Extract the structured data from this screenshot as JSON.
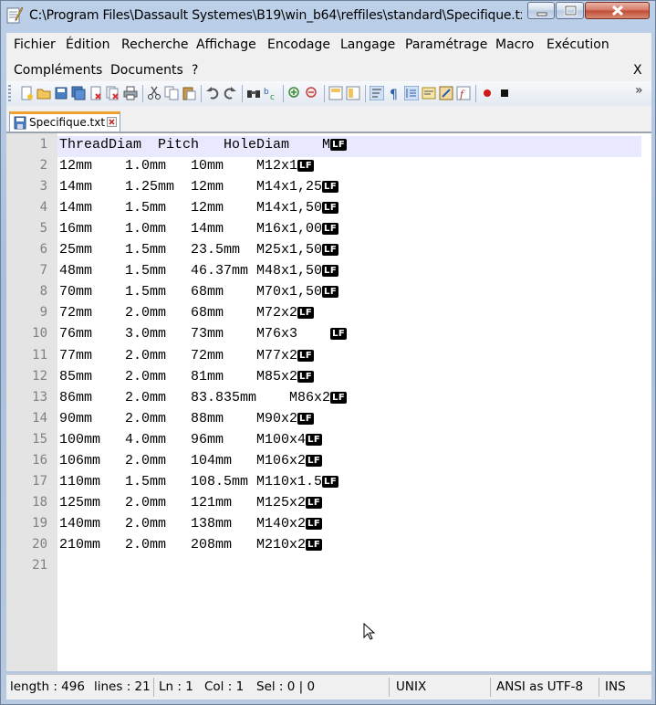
{
  "window": {
    "title": "C:\\Program Files\\Dassault Systemes\\B19\\win_b64\\reffiles\\standard\\Specifique.txt..."
  },
  "menu": {
    "items": [
      "Fichier",
      "Édition",
      "Recherche",
      "Affichage",
      "Encodage",
      "Langage",
      "Paramétrage",
      "Macro",
      "Exécution",
      "Compléments",
      "Documents",
      "?"
    ],
    "close_label": "X"
  },
  "toolbar": {
    "icons": [
      "new-file-icon",
      "open-file-icon",
      "save-icon",
      "save-all-icon",
      "close-icon",
      "close-all-icon",
      "print-icon",
      "cut-icon",
      "copy-icon",
      "paste-icon",
      "undo-icon",
      "redo-icon",
      "find-icon",
      "replace-icon",
      "zoom-in-icon",
      "zoom-out-icon",
      "sync-vertical-icon",
      "sync-horizontal-icon",
      "word-wrap-icon",
      "show-all-chars-icon",
      "indent-guide-icon",
      "user-language-icon",
      "document-map-icon",
      "function-list-icon",
      "record-macro-icon",
      "stop-macro-icon"
    ],
    "overflow": "»"
  },
  "tab": {
    "label": "Specifique.txt"
  },
  "editor": {
    "line_numbers": [
      "1",
      "2",
      "3",
      "4",
      "5",
      "6",
      "7",
      "8",
      "9",
      "10",
      "11",
      "12",
      "13",
      "14",
      "15",
      "16",
      "17",
      "18",
      "19",
      "20",
      "21"
    ],
    "eol_marker": "LF",
    "lines": [
      "ThreadDiam  Pitch   HoleDiam    M",
      "12mm    1.0mm   10mm    M12x1",
      "14mm    1.25mm  12mm    M14x1,25",
      "14mm    1.5mm   12mm    M14x1,50",
      "16mm    1.0mm   14mm    M16x1,00",
      "25mm    1.5mm   23.5mm  M25x1,50",
      "48mm    1.5mm   46.37mm M48x1,50",
      "70mm    1.5mm   68mm    M70x1,50",
      "72mm    2.0mm   68mm    M72x2",
      "76mm    3.0mm   73mm    M76x3    ",
      "77mm    2.0mm   72mm    M77x2",
      "85mm    2.0mm   81mm    M85x2",
      "86mm    2.0mm   83.835mm    M86x2",
      "90mm    2.0mm   88mm    M90x2",
      "100mm   4.0mm   96mm    M100x4",
      "106mm   2.0mm   104mm   M106x2",
      "110mm   1.5mm   108.5mm M110x1.5",
      "125mm   2.0mm   121mm   M125x2",
      "140mm   2.0mm   138mm   M140x2",
      "210mm   2.0mm   208mm   M210x2",
      ""
    ]
  },
  "status": {
    "length": "length : 496",
    "lines": "lines : 21",
    "ln": "Ln : 1",
    "col": "Col : 1",
    "sel": "Sel : 0 | 0",
    "eol": "UNIX",
    "encoding": "ANSI as UTF-8",
    "mode": "INS"
  }
}
